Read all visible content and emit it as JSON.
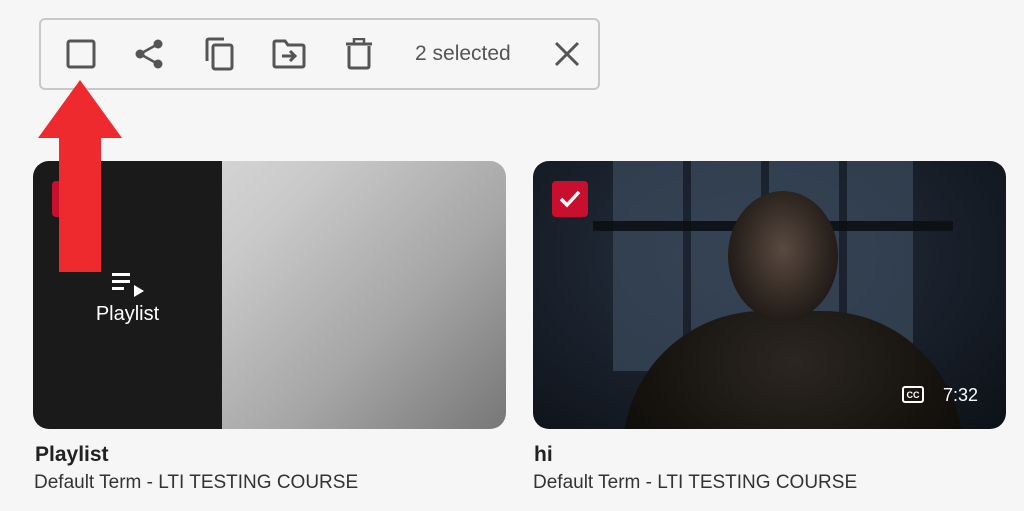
{
  "toolbar": {
    "selected_text": "2 selected",
    "buttons": [
      {
        "name": "select-all",
        "icon": "checkbox-outline-icon"
      },
      {
        "name": "share",
        "icon": "share-icon"
      },
      {
        "name": "copy",
        "icon": "copy-icon"
      },
      {
        "name": "move",
        "icon": "move-to-folder-icon"
      },
      {
        "name": "delete",
        "icon": "trash-icon"
      },
      {
        "name": "close",
        "icon": "close-icon"
      }
    ]
  },
  "cards": [
    {
      "thumbnail_label": "Playlist",
      "title": "Playlist",
      "subtitle": "Default Term - LTI TESTING COURSE",
      "selected": true
    },
    {
      "title": "hi",
      "subtitle": "Default Term - LTI TESTING COURSE",
      "cc_badge": "CC",
      "duration": "7:32",
      "selected": true
    }
  ],
  "colors": {
    "accent_red": "#c8102e",
    "arrow_red": "#ee2a2f",
    "toolbar_icon": "#555555"
  }
}
